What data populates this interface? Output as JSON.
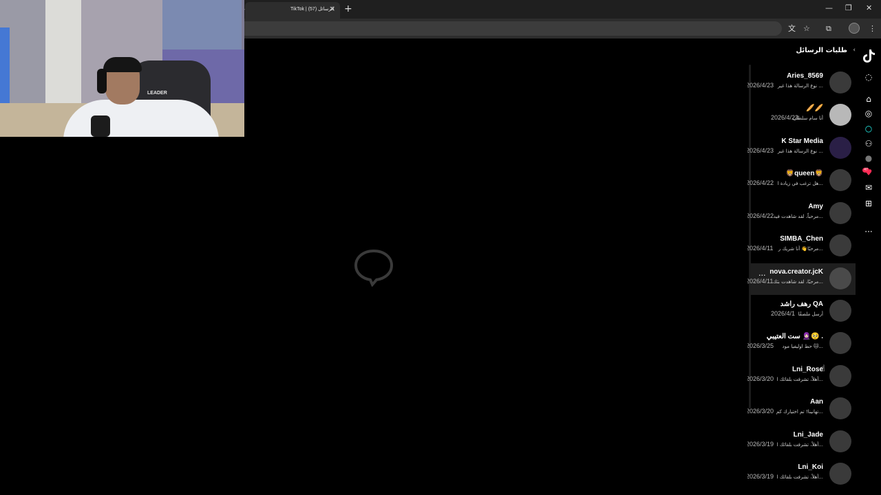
{
  "browser": {
    "tab_prefix": "›",
    "tab_title": "TikTok | الرسائل (57)",
    "tab_close": "×",
    "new_tab": "+",
    "win_min": "—",
    "win_restore": "❐",
    "win_close": "✕",
    "translate_icon": "文",
    "star_icon": "☆",
    "extensions_icon": "⧉",
    "menu_icon": "⋮"
  },
  "webcam": {
    "chair_text": "LEADER"
  },
  "panel": {
    "header": "طلبات الرسائل",
    "back_icon": "‹",
    "conversations": [
      {
        "name": "Aries_8569",
        "preview": "نوع الرسالة هذا غير ...",
        "date": "2026/4/23"
      },
      {
        "name": "🥖🥖",
        "preview": "أنا سام سلطان",
        "date": "2026/4/23"
      },
      {
        "name": "K Star Media",
        "preview": "نوع الرسالة هذا غير ...",
        "date": "2026/4/23"
      },
      {
        "name": "🦁queen🦁",
        "preview": "هل ترغب في زيادة ا...",
        "date": "2026/4/22"
      },
      {
        "name": "Amy",
        "preview": "مرحباً، لقد شاهدت فيد...",
        "date": "2026/4/22"
      },
      {
        "name": "SIMBA_Chen",
        "preview": "مرحبًا👋 أنا شريك ر...",
        "date": "2026/4/11"
      },
      {
        "name": "nova.creator.jcK",
        "preview": "مرحبًا، لقد شاهدت بثك...",
        "date": "2026/4/11"
      },
      {
        "name": "رهف راشد QA",
        "preview": "أرسل ملصقًا",
        "date": "2026/4/1"
      },
      {
        "name": "ست العتيبي 🧕🏻🥺 .",
        "preview": "حط اوليفيا مود 🐱...",
        "date": "2026/3/25"
      },
      {
        "name": "Lni_Rose",
        "preview": "أهلاً، تشرفت بلقائك ا...",
        "date": "2026/3/20"
      },
      {
        "name": "Aan",
        "preview": "تهانينا! تم اختيارك كم...",
        "date": "2026/3/20"
      },
      {
        "name": "Lni_Jade",
        "preview": "أهلاً، تشرفت بلقائك ا...",
        "date": "2026/3/19"
      },
      {
        "name": "Lni_Koi",
        "preview": "أهلاً، تشرفت بلقائك ا...",
        "date": "2026/3/19"
      }
    ],
    "more_icon": "..."
  },
  "rail": {
    "loading_icon": "◌",
    "home_icon": "⌂",
    "explore_icon": "◎",
    "live_icon": "○",
    "following_icon": "⚇",
    "profile_icon": "●",
    "activity_icon": "♥",
    "activity_badge": "47",
    "messages_icon": "✉",
    "upload_icon": "⊞",
    "more_icon": "···"
  },
  "colors": {
    "accent": "#fe2c55",
    "teal": "#25f4ee",
    "background": "#000000"
  }
}
